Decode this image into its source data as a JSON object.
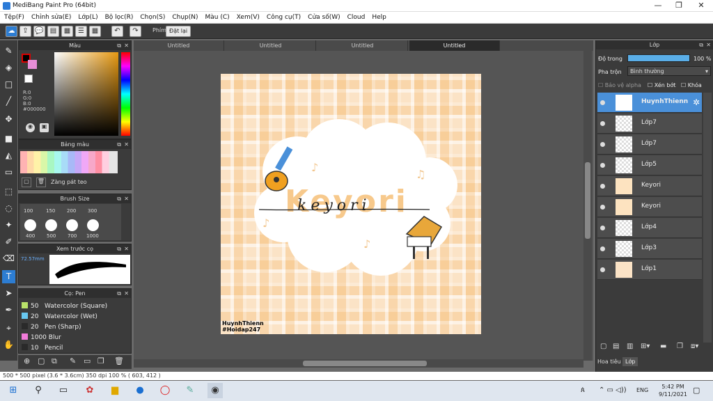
{
  "window": {
    "title": "MediBang Paint Pro (64bit)"
  },
  "menu": [
    "Tệp(F)",
    "Chỉnh sửa(E)",
    "Lớp(L)",
    "Bộ lọc(R)",
    "Chọn(S)",
    "Chụp(N)",
    "Màu (C)",
    "Xem(V)",
    "Công cụ(T)",
    "Cửa số(W)",
    "Cloud",
    "Help"
  ],
  "toolbar": {
    "phim_label": "Phím",
    "reset_label": "Đặt lại"
  },
  "color_panel": {
    "title": "Màu",
    "r": "R:0",
    "g": "G:0",
    "b": "B:0",
    "hex": "#000000"
  },
  "palette_panel": {
    "title": "Bảng màu",
    "palette_name": "Zàng pát teo"
  },
  "brush_size_panel": {
    "title": "Brush Size",
    "sizes_top": [
      "100",
      "150",
      "200",
      "300"
    ],
    "sizes_bottom": [
      "400",
      "500",
      "700",
      "1000"
    ]
  },
  "preview_panel": {
    "title": "Xem trước cọ",
    "size": "72.57mm"
  },
  "brush_panel": {
    "title": "Cọ: Pen",
    "items": [
      {
        "size": "50",
        "name": "Watercolor (Square)",
        "color": "#b9e26a"
      },
      {
        "size": "20",
        "name": "Watercolor (Wet)",
        "color": "#68c8f0"
      },
      {
        "size": "20",
        "name": "Pen (Sharp)",
        "color": "#2a2a2a"
      },
      {
        "size": "1000",
        "name": "Blur",
        "color": "#f17bd9"
      },
      {
        "size": "10",
        "name": "Pencil",
        "color": "#2a2a2a"
      }
    ]
  },
  "tabs": [
    "Untitled",
    "Untitled",
    "Untitled",
    "Untitled"
  ],
  "canvas": {
    "title_text": "Keyori",
    "script_text": "keyori",
    "watermark_line1": "HuynhThienn",
    "watermark_line2": "#Hoidap247"
  },
  "layer_panel": {
    "title": "Lớp",
    "opacity_label": "Độ trong",
    "opacity_value": "100 %",
    "blend_label": "Pha trộn",
    "blend_value": "Bình thường",
    "protect_alpha": "Bảo vệ alpha",
    "clip": "Xén bớt",
    "lock": "Khóa",
    "layers": [
      "HuynhThienn",
      "Lớp7",
      "Lớp7",
      "Lớp5",
      "Keyori",
      "Keyori",
      "Lớp4",
      "Lớp3",
      "Lớp1"
    ],
    "bottom_tabs": [
      "Hoa tiêu",
      "Lớp"
    ]
  },
  "status": {
    "text": "500 * 500 pixel  (3.6 * 3.6cm)  350 dpi  100 %  ( 603, 412 )"
  },
  "taskbar": {
    "lang": "ENG",
    "time": "5:42 PM",
    "date": "9/11/2021"
  }
}
